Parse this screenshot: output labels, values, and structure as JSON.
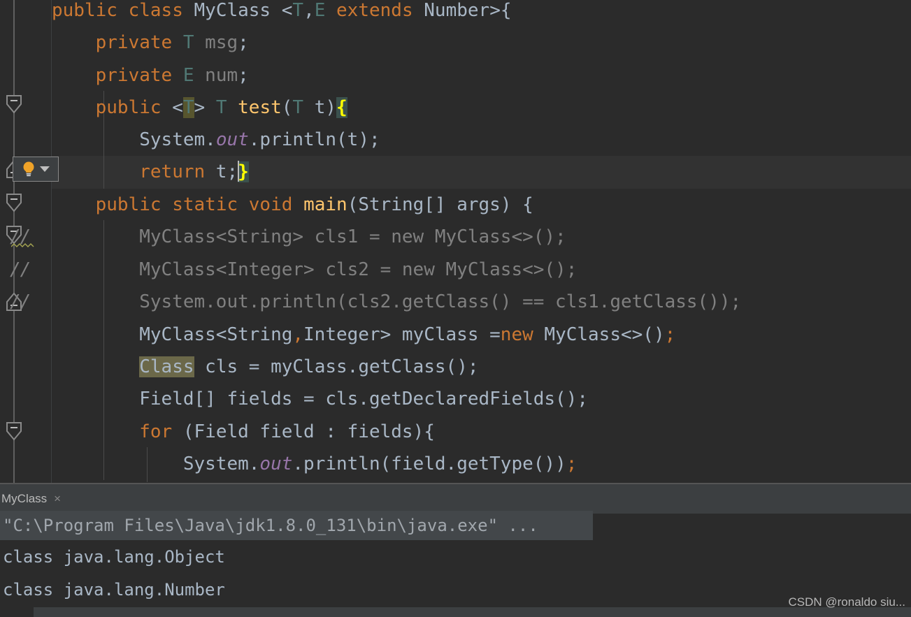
{
  "editor": {
    "language": "java",
    "theme": "Darcula",
    "colors": {
      "background": "#2b2b2b",
      "text": "#a9b7c6",
      "keyword": "#cc7832",
      "comment": "#808080",
      "method": "#ffc66d",
      "field_static": "#9876aa",
      "type_param": "#507874",
      "brace_match_bg": "#3b514d",
      "brace_match_fg": "#ffff00",
      "identifier_highlight_bg": "#6b6849",
      "caret_line_bg": "#323232",
      "gutter_bg": "#2b2b2b",
      "console_tab_bg": "#3c3f41"
    },
    "lines": [
      {
        "n": 1,
        "gutter": "",
        "tokens": [
          {
            "t": "public",
            "c": "kw"
          },
          {
            "t": " ",
            "c": "id"
          },
          {
            "t": "class",
            "c": "kw"
          },
          {
            "t": " ",
            "c": "id"
          },
          {
            "t": "MyClass",
            "c": "id"
          },
          {
            "t": " <",
            "c": "id"
          },
          {
            "t": "T",
            "c": "gen"
          },
          {
            "t": ",",
            "c": "id"
          },
          {
            "t": "E",
            "c": "gen"
          },
          {
            "t": " ",
            "c": "id"
          },
          {
            "t": "extends",
            "c": "kw"
          },
          {
            "t": " ",
            "c": "id"
          },
          {
            "t": "Number",
            "c": "id"
          },
          {
            "t": ">{",
            "c": "id"
          }
        ]
      },
      {
        "n": 2,
        "gutter": "",
        "tokens": [
          {
            "t": "    ",
            "c": "id"
          },
          {
            "t": "private",
            "c": "kw"
          },
          {
            "t": " ",
            "c": "id"
          },
          {
            "t": "T",
            "c": "gen"
          },
          {
            "t": " ",
            "c": "id"
          },
          {
            "t": "msg",
            "c": "cmt"
          },
          {
            "t": ";",
            "c": "id"
          }
        ]
      },
      {
        "n": 3,
        "gutter": "",
        "tokens": [
          {
            "t": "    ",
            "c": "id"
          },
          {
            "t": "private",
            "c": "kw"
          },
          {
            "t": " ",
            "c": "id"
          },
          {
            "t": "E",
            "c": "gen"
          },
          {
            "t": " ",
            "c": "id"
          },
          {
            "t": "num",
            "c": "cmt"
          },
          {
            "t": ";",
            "c": "id"
          }
        ]
      },
      {
        "n": 4,
        "gutter": "fold-down",
        "tokens": [
          {
            "t": "    ",
            "c": "id"
          },
          {
            "t": "public",
            "c": "kw"
          },
          {
            "t": " <",
            "c": "id"
          },
          {
            "t": "T",
            "c": "gen tparam-hl"
          },
          {
            "t": "> ",
            "c": "id"
          },
          {
            "t": "T",
            "c": "gen"
          },
          {
            "t": " ",
            "c": "id"
          },
          {
            "t": "test",
            "c": "mth"
          },
          {
            "t": "(",
            "c": "id"
          },
          {
            "t": "T",
            "c": "gen"
          },
          {
            "t": " t)",
            "c": "id"
          },
          {
            "t": "{",
            "c": "brace-match"
          }
        ]
      },
      {
        "n": 5,
        "gutter": "",
        "tokens": [
          {
            "t": "        ",
            "c": "id"
          },
          {
            "t": "System",
            "c": "id"
          },
          {
            "t": ".",
            "c": "id"
          },
          {
            "t": "out",
            "c": "fld"
          },
          {
            "t": ".println(t);",
            "c": "id"
          }
        ]
      },
      {
        "n": 6,
        "gutter": "fold-up-bulb",
        "caret_line": true,
        "tokens": [
          {
            "t": "        ",
            "c": "id"
          },
          {
            "t": "return",
            "c": "kw"
          },
          {
            "t": " t;",
            "c": "id"
          },
          {
            "t": "}",
            "c": "brace-match",
            "caret_before": true
          }
        ]
      },
      {
        "n": 7,
        "gutter": "fold-down",
        "tokens": [
          {
            "t": "    ",
            "c": "id"
          },
          {
            "t": "public",
            "c": "kw"
          },
          {
            "t": " ",
            "c": "id"
          },
          {
            "t": "static",
            "c": "kw"
          },
          {
            "t": " ",
            "c": "id"
          },
          {
            "t": "void",
            "c": "kw"
          },
          {
            "t": " ",
            "c": "id"
          },
          {
            "t": "main",
            "c": "mth"
          },
          {
            "t": "(String[] args) {",
            "c": "id"
          }
        ]
      },
      {
        "n": 8,
        "gutter": "fold-down-comment-squiggle",
        "gutter_text": "//",
        "tokens": [
          {
            "t": "        MyClass<String> cls1 = new MyClass<>();",
            "c": "cmt"
          }
        ]
      },
      {
        "n": 9,
        "gutter": "comment",
        "gutter_text": "//",
        "tokens": [
          {
            "t": "        MyClass<Integer> cls2 = new MyClass<>();",
            "c": "cmt"
          }
        ]
      },
      {
        "n": 10,
        "gutter": "fold-up-comment",
        "gutter_text": "//",
        "tokens": [
          {
            "t": "        System.out.println(cls2.getClass() == cls1.getClass());",
            "c": "cmt"
          }
        ]
      },
      {
        "n": 11,
        "gutter": "",
        "tokens": [
          {
            "t": "        MyClass<String",
            "c": "id"
          },
          {
            "t": ",",
            "c": "kw"
          },
          {
            "t": "Integer> myClass =",
            "c": "id"
          },
          {
            "t": "new",
            "c": "kw"
          },
          {
            "t": " MyClass<>()",
            "c": "id"
          },
          {
            "t": ";",
            "c": "kw"
          }
        ]
      },
      {
        "n": 12,
        "gutter": "",
        "tokens": [
          {
            "t": "        ",
            "c": "id"
          },
          {
            "t": "Class",
            "c": "id ident-hl"
          },
          {
            "t": " cls = myClass.getClass();",
            "c": "id"
          }
        ]
      },
      {
        "n": 13,
        "gutter": "",
        "tokens": [
          {
            "t": "        Field[] fields = cls.getDeclaredFields();",
            "c": "id"
          }
        ]
      },
      {
        "n": 14,
        "gutter": "fold-down",
        "tokens": [
          {
            "t": "        ",
            "c": "id"
          },
          {
            "t": "for",
            "c": "kw"
          },
          {
            "t": " (Field field : fields){",
            "c": "id"
          }
        ]
      },
      {
        "n": 15,
        "gutter": "",
        "tokens": [
          {
            "t": "            ",
            "c": "id"
          },
          {
            "t": "System",
            "c": "id"
          },
          {
            "t": ".",
            "c": "id"
          },
          {
            "t": "out",
            "c": "fld"
          },
          {
            "t": ".println(field.getType())",
            "c": "id"
          },
          {
            "t": ";",
            "c": "kw"
          }
        ]
      }
    ]
  },
  "console": {
    "tab": {
      "label": "MyClass",
      "close_glyph": "×"
    },
    "output": [
      {
        "text": "\"C:\\Program Files\\Java\\jdk1.8.0_131\\bin\\java.exe\" ...",
        "style": "command"
      },
      {
        "text": "class java.lang.Object",
        "style": "normal"
      },
      {
        "text": "class java.lang.Number",
        "style": "normal"
      }
    ]
  },
  "watermark": {
    "text": "CSDN @ronaldo siu..."
  },
  "icons": {
    "lightbulb": "lightbulb-icon",
    "dropdown_arrow": "chevron-down-icon",
    "fold_minus": "fold-minus-icon"
  }
}
